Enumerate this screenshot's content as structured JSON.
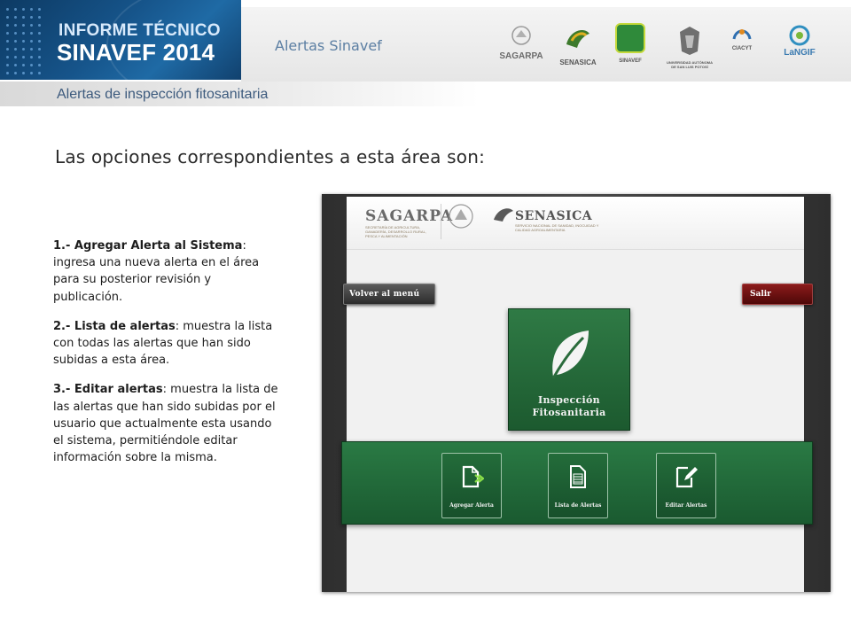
{
  "header": {
    "banner_line1": "INFORME TÉCNICO",
    "banner_line2": "SINAVEF 2014",
    "title": "Alertas Sinavef",
    "logos": [
      {
        "name": "sagarpa-logo",
        "caption": "SAGARPA"
      },
      {
        "name": "senasica-logo",
        "caption": "SENASICA"
      },
      {
        "name": "sinavef-logo",
        "caption": "SINAVEF"
      },
      {
        "name": "uanl-logo",
        "caption": "UNIVERSIDAD AUTÓNOMA DE SAN LUIS POTOSÍ"
      },
      {
        "name": "uaslp-logo",
        "caption": "CIACYT"
      },
      {
        "name": "langif-logo",
        "caption": "LaNGIF"
      }
    ]
  },
  "subtitle": "Alertas de inspección fitosanitaria",
  "heading": "Las opciones correspondientes a esta área son:",
  "items": [
    {
      "label": "1.- Agregar Alerta al Sistema",
      "text": ": ingresa una nueva alerta en el área para su posterior revisión y publicación."
    },
    {
      "label": "2.- Lista de alertas",
      "text": ": muestra la lista con todas las alertas que han sido subidas a esta área."
    },
    {
      "label": "3.- Editar alertas",
      "text": ": muestra la lista de las alertas que han sido subidas por el usuario que actualmente esta usando el sistema, permitiéndole editar información sobre la misma."
    }
  ],
  "screenshot": {
    "sagarpa": "SAGARPA",
    "sagarpa_sub": "SECRETARÍA DE AGRICULTURA, GANADERÍA, DESARROLLO RURAL, PESCA Y ALIMENTACIÓN",
    "senasica": "SENASICA",
    "senasica_sub": "SERVICIO NACIONAL DE SANIDAD, INOCUIDAD Y CALIDAD AGROALIMENTARIA",
    "back_button": "Volver al menú",
    "exit_button": "Salir",
    "main_tile_line1": "Inspección",
    "main_tile_line2": "Fitosanitaria",
    "sub_tiles": [
      "Agregar Alerta",
      "Lista de Alertas",
      "Editar Alertas"
    ]
  },
  "colors": {
    "banner_blue": "#16548a",
    "tile_green": "#1c5a2f",
    "exit_red": "#8b1b1b",
    "title_blue": "#5c7fa3"
  }
}
